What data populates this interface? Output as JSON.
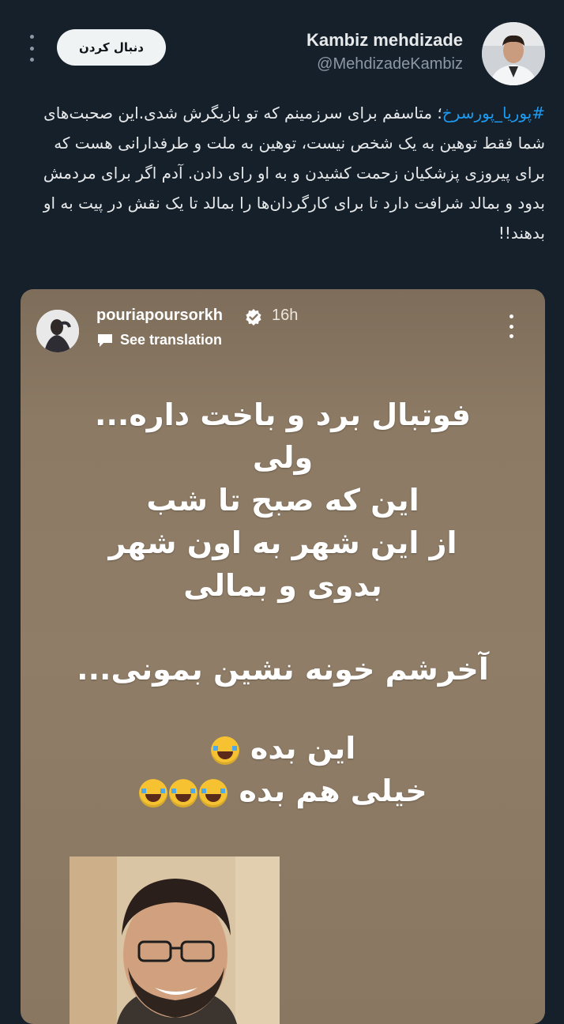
{
  "header": {
    "display_name": "Kambiz mehdizade",
    "handle": "@MehdizadeKambiz",
    "follow_label": "دنبال کردن"
  },
  "tweet": {
    "hashtag": "#پوریا_پورسرخ",
    "body": "؛ متاسفم برای سرزمینم که تو بازیگرش شدی.این صحبت‌های شما فقط توهین به یک شخص نیست، توهین به ملت و طرفدارانی هست که برای پیروزی پزشکیان زحمت کشیدن و به او رای دادن. آدم اگر برای مردمش بدود و بمالد شرافت دارد تا برای کارگردان‌ها را بمالد تا یک نقش در پیت به او بدهند!!"
  },
  "story": {
    "username": "pouriapoursorkh",
    "time": "16h",
    "translate_label": "See translation",
    "lines": [
      "فوتبال برد و باخت داره...",
      "ولی",
      "این که صبح تا شب",
      "از این شهر به اون شهر",
      "بدوی و بمالی",
      "آخرشم خونه نشین بمونی...",
      "این بده",
      "خیلی هم بده"
    ]
  },
  "icons": {
    "more": "more-vertical-icon",
    "verified": "verified-badge-icon",
    "translate": "translate-icon",
    "laugh_emoji": "face-with-tears-of-joy-icon"
  },
  "colors": {
    "background": "#15202b",
    "link": "#1d9bf0",
    "follow_button": "#eff3f4"
  }
}
